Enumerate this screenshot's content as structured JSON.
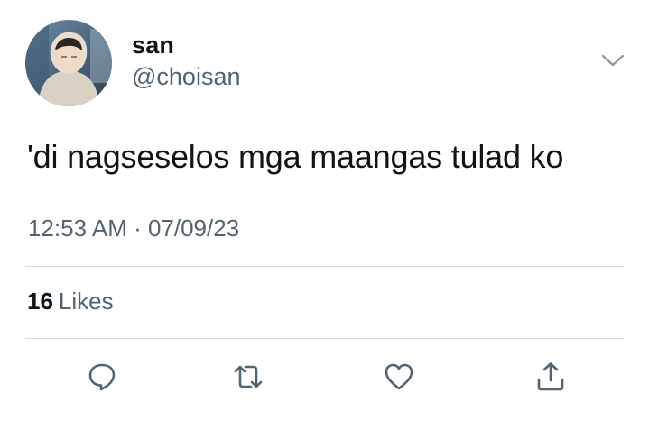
{
  "author": {
    "display_name": "san",
    "handle": "@choisan"
  },
  "tweet": {
    "text": "'di nagseselos mga maangas tulad ko",
    "timestamp": "12:53 AM · 07/09/23"
  },
  "stats": {
    "likes_count": "16",
    "likes_label": "Likes"
  },
  "actions": [
    "reply-icon",
    "retweet-icon",
    "like-icon",
    "share-icon"
  ],
  "colors": {
    "primary_text": "#0f1419",
    "secondary_text": "#536471",
    "divider": "#cfd9de",
    "icon": "#536471"
  }
}
